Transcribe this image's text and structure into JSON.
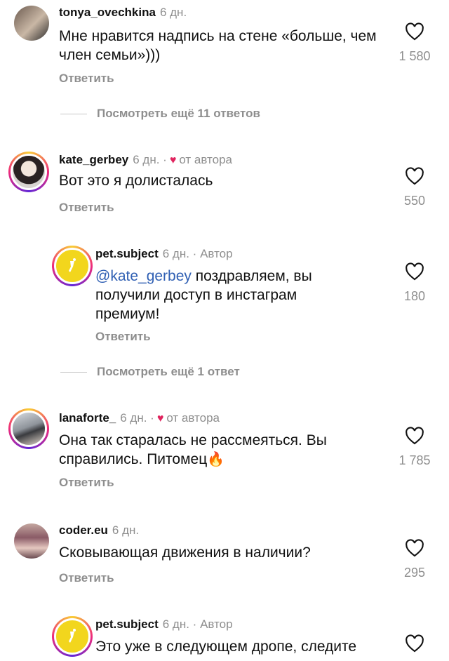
{
  "comments": [
    {
      "username": "tonya_ovechkina",
      "time": "6 дн.",
      "text": "Мне нравится надпись на стене «больше, чем член семьи»)))",
      "reply_label": "Ответить",
      "likes": "1 580"
    },
    {
      "username": "kate_gerbey",
      "time": "6 дн. ·",
      "author_badge": "от автора",
      "text": "Вот это я долисталась",
      "reply_label": "Ответить",
      "likes": "550"
    },
    {
      "username": "pet.subject",
      "time": "6 дн. · Автор",
      "mention": "@kate_gerbey",
      "text": " поздравляем, вы получили доступ в инстаграм премиум!",
      "reply_label": "Ответить",
      "likes": "180"
    },
    {
      "username": "lanaforte_",
      "time": "6 дн. ·",
      "author_badge": "от автора",
      "text": "Она так старалась не рассмеяться. Вы справились. Питомец",
      "reply_label": "Ответить",
      "likes": "1 785"
    },
    {
      "username": "coder.eu",
      "time": "6 дн.",
      "text": "Сковывающая движения в наличии?",
      "reply_label": "Ответить",
      "likes": "295"
    },
    {
      "username": "pet.subject",
      "time": "6 дн. · Автор",
      "text": "Это уже в следующем дропе, следите"
    }
  ],
  "view_more": [
    "Посмотреть ещё 11 ответов",
    "Посмотреть ещё 1 ответ"
  ],
  "icons": {
    "like": "heart-outline-icon",
    "author_like": "heart-filled-icon",
    "fire": "fire-emoji"
  },
  "colors": {
    "author_heart": "#e0245e",
    "mention": "#2f5fb3",
    "brand_yellow": "#f2d61d"
  }
}
